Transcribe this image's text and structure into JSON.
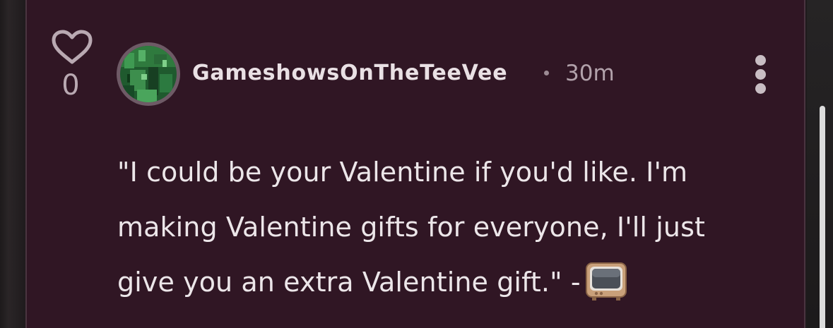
{
  "vote": {
    "count": "0",
    "icon": "heart-outline-icon"
  },
  "author": {
    "username": "GameshowsOnTheTeeVee",
    "avatar": "green-avatar-image"
  },
  "separator": "•",
  "timestamp": "30m",
  "menu_icon": "more-vertical-icon",
  "comment": {
    "lines": [
      "\"I could be your Valentine if you'd like. I'm",
      "making Valentine gifts for everyone, I'll just",
      "give you an extra Valentine gift.\" -"
    ],
    "emoji": "television-emoji"
  },
  "colors": {
    "card_background": "#301624",
    "text_primary": "#ece6e9",
    "text_muted": "#b2a2ab"
  }
}
